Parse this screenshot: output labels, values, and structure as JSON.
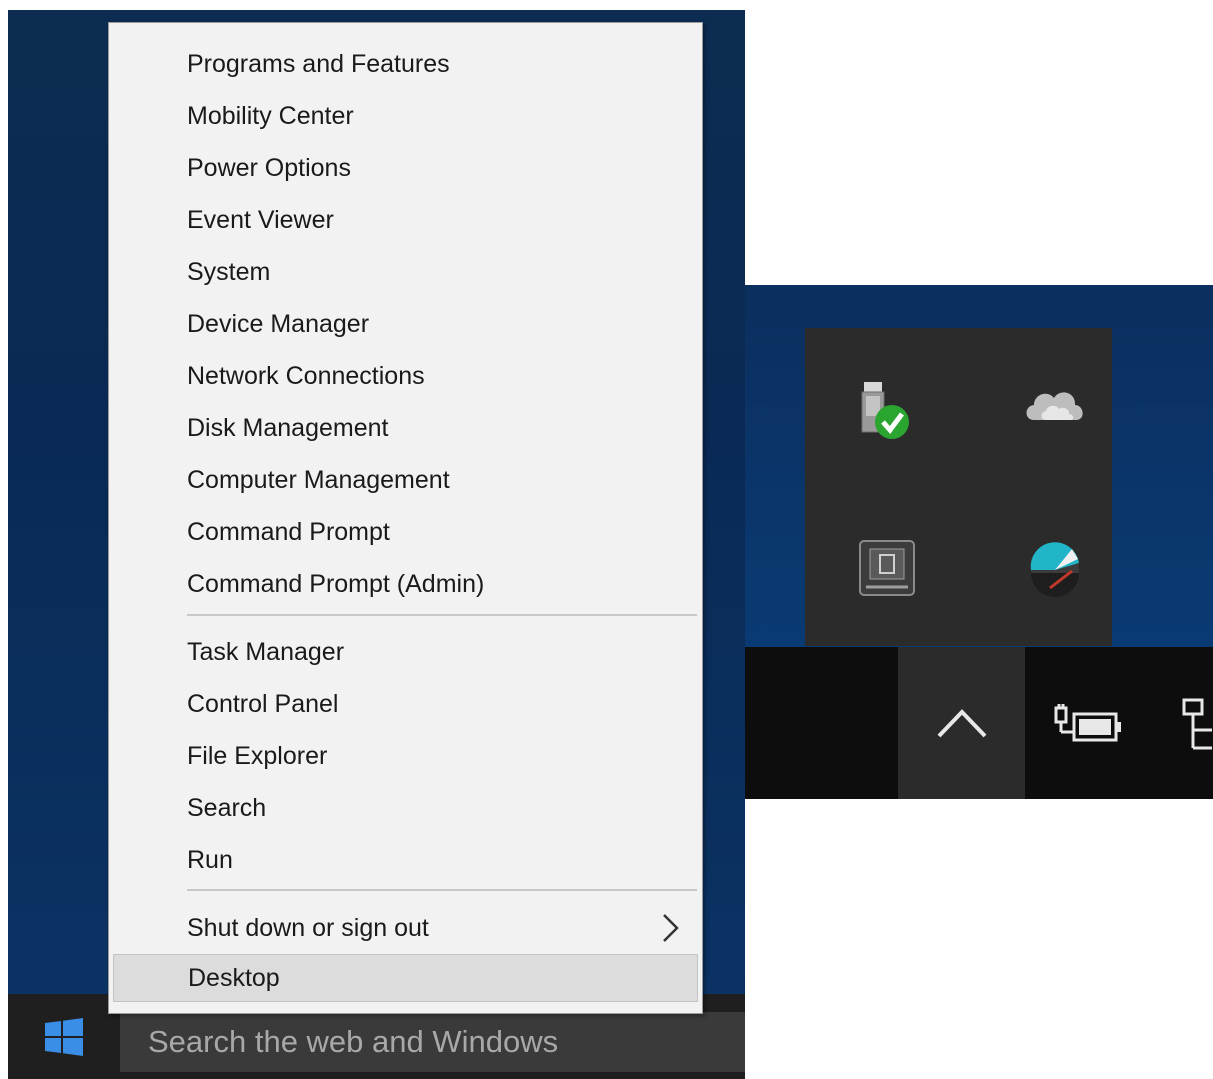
{
  "context_menu": {
    "group1": [
      "Programs and Features",
      "Mobility Center",
      "Power Options",
      "Event Viewer",
      "System",
      "Device Manager",
      "Network Connections",
      "Disk Management",
      "Computer Management",
      "Command Prompt",
      "Command Prompt (Admin)"
    ],
    "group2": [
      "Task Manager",
      "Control Panel",
      "File Explorer",
      "Search",
      "Run"
    ],
    "shutdown_label": "Shut down or sign out",
    "desktop_label": "Desktop"
  },
  "taskbar": {
    "search_placeholder": "Search the web and Windows"
  },
  "tray": {
    "icons": [
      "usb-safely-remove-icon",
      "onedrive-cloud-icon",
      "keyboard-driver-icon",
      "app-tray-icon"
    ],
    "taskbar_icons": [
      "chevron-up-icon",
      "power-battery-icon",
      "network-icon"
    ]
  },
  "colors": {
    "desktop": "#0a2a55",
    "taskbar": "#1f1f1f",
    "menu_background": "#f2f2f2",
    "menu_highlight": "#dcdcdc",
    "windows_blue": "#3a8ee6"
  }
}
